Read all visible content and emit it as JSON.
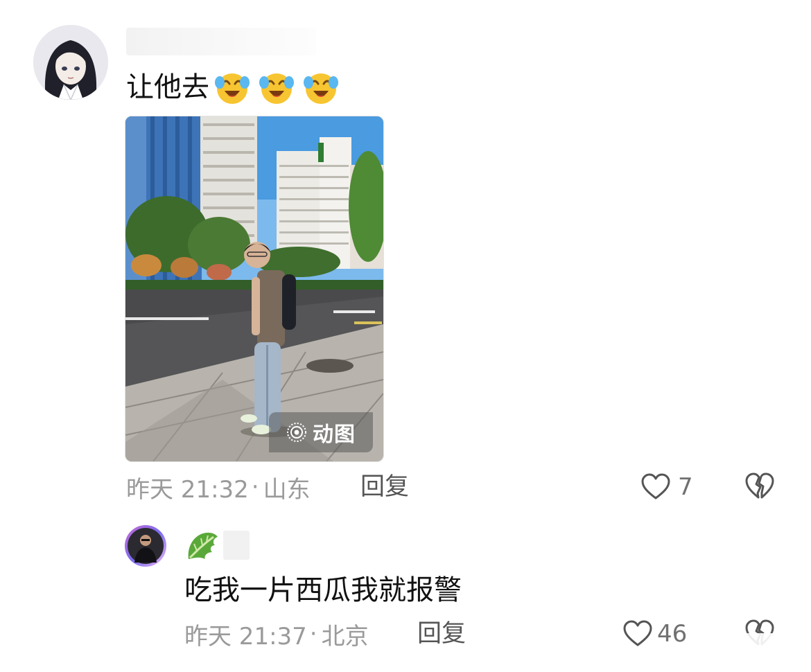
{
  "comment": {
    "text": "让他去",
    "emojis": [
      "crying-laugh-emoji",
      "crying-laugh-emoji",
      "crying-laugh-emoji"
    ],
    "image_badge": "动图",
    "meta": {
      "date": "昨天 21:32",
      "separator": "·",
      "location": "山东"
    },
    "reply_label": "回复",
    "likes": "7"
  },
  "reply": {
    "name_icon": "lettuce-emoji",
    "text": "吃我一片西瓜我就报警",
    "meta": {
      "date": "昨天 21:37",
      "separator": "·",
      "location": "北京"
    },
    "reply_label": "回复",
    "likes": "46"
  },
  "icons": {
    "like": "heart-icon",
    "dislike": "broken-heart-icon",
    "gif": "live-photo-icon"
  },
  "colors": {
    "text_primary": "#111111",
    "text_meta": "#9a9a9a",
    "reply_label": "#555555",
    "icon_stroke": "#555555",
    "emoji_yellow": "#f7c531",
    "emoji_tear": "#5ab7f0"
  }
}
